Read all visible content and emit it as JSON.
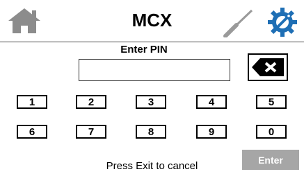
{
  "header": {
    "title": "MCX",
    "icons": [
      "home-icon",
      "screwdriver-icon",
      "gear-wrench-icon"
    ]
  },
  "pin_entry": {
    "label": "Enter PIN",
    "value": "",
    "backspace_icon": "backspace-x-icon"
  },
  "keypad": {
    "row1": [
      "1",
      "2",
      "3",
      "4",
      "5"
    ],
    "row2": [
      "6",
      "7",
      "8",
      "9",
      "0"
    ]
  },
  "footer": {
    "cancel_hint": "Press Exit to cancel",
    "enter_label": "Enter"
  },
  "colors": {
    "icon_gray": "#8c8c8c",
    "settings_blue": "#1f6fb5",
    "enter_disabled": "#a6a6a6"
  }
}
